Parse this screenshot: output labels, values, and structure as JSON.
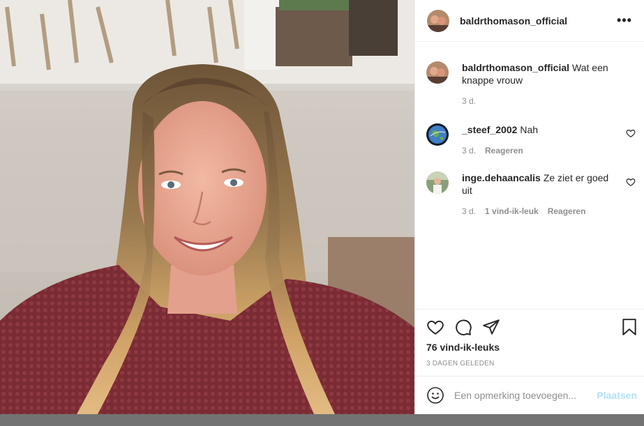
{
  "post": {
    "author": "baldrthomason_official",
    "more_icon": "more-horizontal-icon",
    "photo_alt": "smiling woman with long hair in maroon sweater"
  },
  "caption": {
    "username": "baldrthomason_official",
    "text": "Wat een knappe vrouw",
    "time": "3 d."
  },
  "comments": [
    {
      "username": "_steef_2002",
      "text": "Nah",
      "time": "3 d.",
      "likes": "",
      "reply_label": "Reageren"
    },
    {
      "username": "inge.dehaancalis",
      "text": "Ze ziet er goed uit",
      "time": "3 d.",
      "likes": "1 vind-ik-leuk",
      "reply_label": "Reageren"
    }
  ],
  "actions": {
    "like_icon": "heart-icon",
    "comment_icon": "comment-icon",
    "share_icon": "paper-plane-icon",
    "save_icon": "bookmark-icon"
  },
  "likes_text": "76 vind-ik-leuks",
  "date_text": "3 DAGEN GELEDEN",
  "add_comment": {
    "placeholder": "Een opmerking toevoegen...",
    "post_label": "Plaatsen",
    "emoji_icon": "smiley-icon"
  },
  "colors": {
    "text": "#262626",
    "muted": "#8e8e8e",
    "border": "#efefef",
    "post_disabled": "#b2dffc",
    "sweater": "#7a2b33",
    "hair": "#8a6a44"
  }
}
